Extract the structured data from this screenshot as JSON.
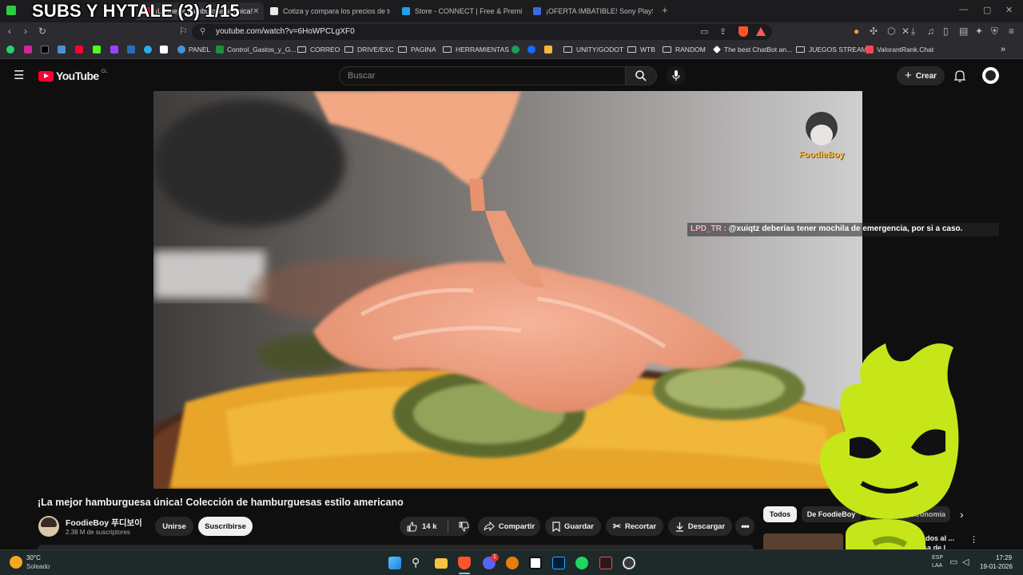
{
  "overlay": {
    "stream_title": "SUBS Y HYTALE (3) 1/15"
  },
  "browser": {
    "tabs": [
      {
        "label": "¡La mejor hamburguesa única!",
        "active": true,
        "color": "#ff0033"
      },
      {
        "label": "Cotiza y compara los precios de todo",
        "active": false,
        "color": "#e8e8e8"
      },
      {
        "label": "Store - CONNECT | Free & Premium",
        "active": false,
        "color": "#1ea1f2"
      },
      {
        "label": "¡OFERTA IMBATIBLE! Sony PlayStation",
        "active": false,
        "color": "#3b6bdc"
      }
    ],
    "new_tab": "+",
    "url": "youtube.com/watch?v=6HoWPCLgXF0",
    "bookmarks": [
      {
        "label": "PANEL",
        "type": "site",
        "color": "#4a90d9"
      },
      {
        "label": "Control_Gastos_y_G...",
        "type": "site",
        "color": "#1e8e3e"
      },
      {
        "label": "CORREO",
        "type": "folder"
      },
      {
        "label": "DRIVE/EXC",
        "type": "folder"
      },
      {
        "label": "PAGINA",
        "type": "folder"
      },
      {
        "label": "HERRAMIENTAS",
        "type": "folder"
      },
      {
        "label": "UNITY/GODOT",
        "type": "folder"
      },
      {
        "label": "WTB",
        "type": "folder"
      },
      {
        "label": "RANDOM",
        "type": "folder"
      },
      {
        "label": "The best ChatBot an...",
        "type": "site",
        "color": "#ffffff"
      },
      {
        "label": "JUEGOS STREAM",
        "type": "folder"
      },
      {
        "label": "ValorantRank.Chat",
        "type": "site",
        "color": "#ff4655"
      }
    ]
  },
  "youtube": {
    "logo_text": "YouTube",
    "region": "CL",
    "search_placeholder": "Buscar",
    "create_label": "Crear"
  },
  "video": {
    "chat_user": "LPD_TR :",
    "chat_message": "@xuiqtz deberías tener mochila de emergencia, por si a caso.",
    "watermark": "FoodieBoy"
  },
  "meta": {
    "title": "¡La mejor hamburguesa única! Colección de hamburguesas estilo americano",
    "channel_name": "FoodieBoy 푸디보이",
    "subscribers": "2.38 M de suscriptores",
    "join_label": "Unirse",
    "subscribe_label": "Suscribirse",
    "likes": "14 k",
    "share_label": "Compartir",
    "save_label": "Guardar",
    "clip_label": "Recortar",
    "download_label": "Descargar"
  },
  "sidebar_chips": [
    "Todos",
    "De FoodieBoy",
    "Gastronomía"
  ],
  "suggested_snippet": "tados al ... esa de l",
  "taskbar": {
    "weather_temp": "30°C",
    "weather_desc": "Soleado",
    "lang": "ESP",
    "lang2": "LAA",
    "time": "17:29",
    "date": "19-01-2026",
    "discord_badge": "1"
  }
}
